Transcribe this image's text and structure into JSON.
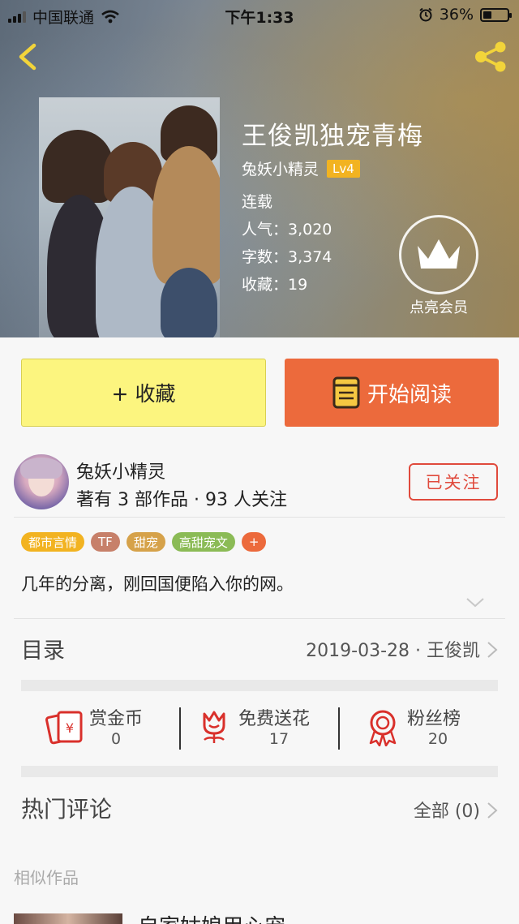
{
  "status_bar": {
    "carrier": "中国联通",
    "time": "下午1:33",
    "battery_percent": "36%",
    "battery_level": 0.36
  },
  "header": {
    "back_icon": "chevron-left-icon",
    "share_icon": "share-icon"
  },
  "book": {
    "title": "王俊凯独宠青梅",
    "author": "兔妖小精灵",
    "level": "Lv4",
    "status": "连载",
    "popularity": "人气：3,020",
    "word_count": "字数：3,374",
    "favorites": "收藏：19"
  },
  "vip": {
    "label": "点亮会员",
    "icon": "crown-icon"
  },
  "actions": {
    "favorite_label": "+ 收藏",
    "read_label": "开始阅读",
    "read_icon": "book-icon"
  },
  "author_card": {
    "name": "兔妖小精灵",
    "stats": "著有 3 部作品 · 93 人关注",
    "follow_label": "已关注"
  },
  "tags": [
    {
      "label": "都市言情",
      "color": "#f2b321"
    },
    {
      "label": "TF",
      "color": "#c7806a"
    },
    {
      "label": "甜宠",
      "color": "#d6a24a"
    },
    {
      "label": "高甜宠文",
      "color": "#8bbb56"
    },
    {
      "label": "+",
      "color": "#ec6a3c"
    }
  ],
  "summary": "几年的分离，刚回国便陷入你的网。",
  "toc": {
    "title": "目录",
    "latest": "2019-03-28 · 王俊凯"
  },
  "stats": [
    {
      "label": "赏金币",
      "value": "0",
      "icon": "red-envelope-icon"
    },
    {
      "label": "免费送花",
      "value": "17",
      "icon": "flower-icon"
    },
    {
      "label": "粉丝榜",
      "value": "20",
      "icon": "ribbon-badge-icon"
    }
  ],
  "comments": {
    "title": "热门评论",
    "all_label": "全部 (0)"
  },
  "similar": {
    "title": "相似作品",
    "first_item_title": "自家姑娘用心宠"
  },
  "colors": {
    "accent_orange": "#ec6a3c",
    "favorite_yellow": "#fcf57f",
    "follow_red": "#e04a3c",
    "level_badge": "#f2b321"
  }
}
